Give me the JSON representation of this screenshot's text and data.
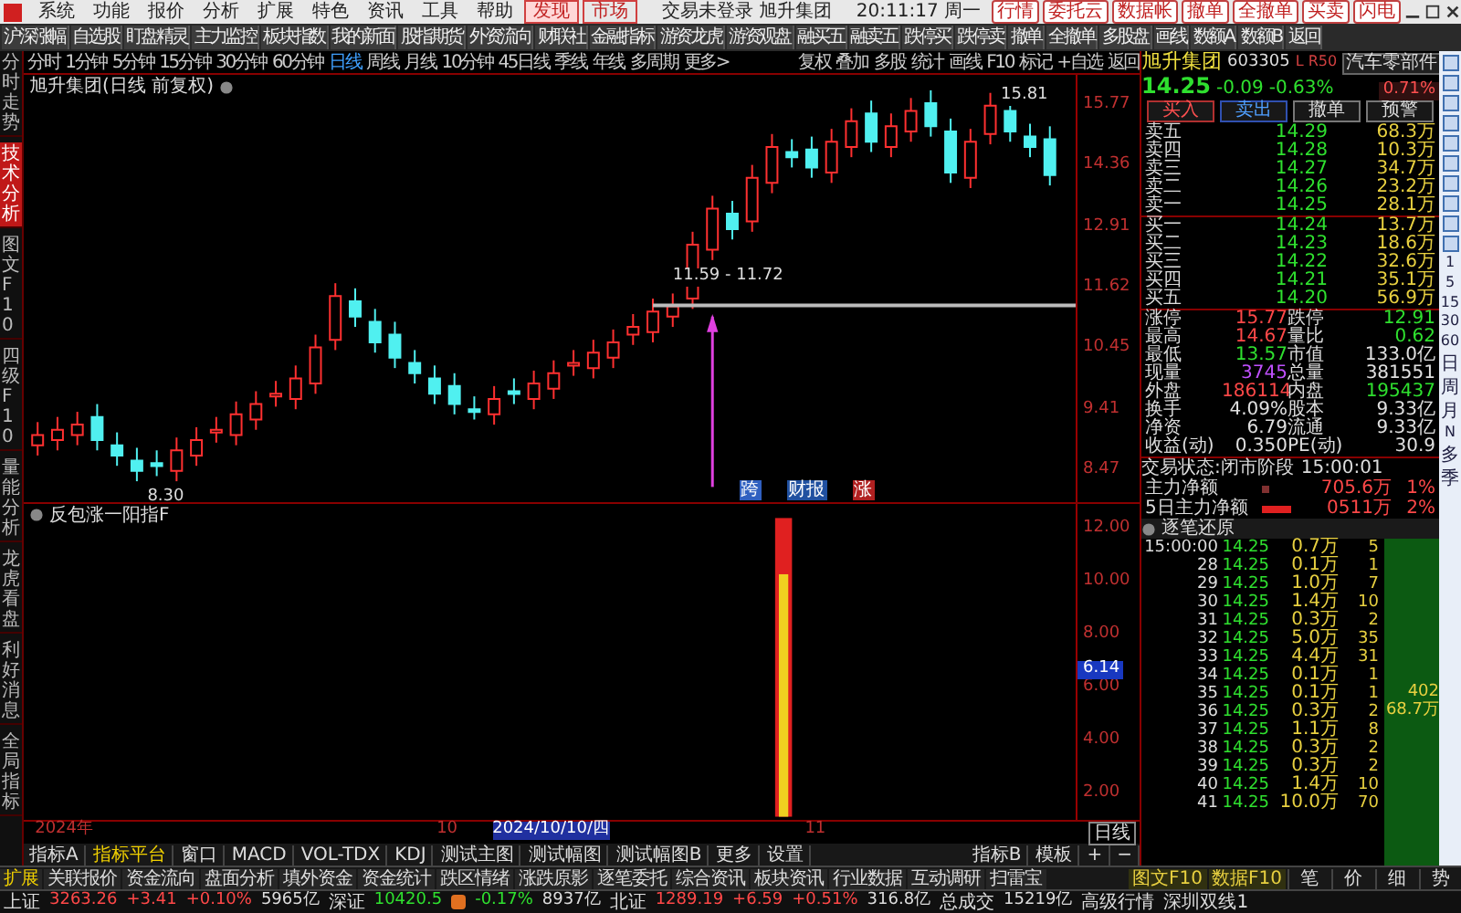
{
  "menu": {
    "items": [
      "系统",
      "功能",
      "报价",
      "分析",
      "扩展",
      "特色",
      "资讯",
      "工具",
      "帮助"
    ],
    "tabs": [
      {
        "label": "发现",
        "selected": true
      },
      {
        "label": "市场",
        "selected": false
      }
    ],
    "title": "交易未登录  旭升集团",
    "clock": "20:11:17 周一",
    "quick_buttons": [
      "行情",
      "委托云",
      "数据帐",
      "撤单",
      "全撤单",
      "买卖",
      "闪电"
    ]
  },
  "toolbar": [
    "沪深涨幅",
    "自选股",
    "盯盘精灵",
    "主力监控",
    "板块指数",
    "我的新面",
    "股指期货",
    "外资流向",
    "财联社",
    "金融指标",
    "游资龙虎",
    "游资观盘",
    "融买五",
    "融卖五",
    "跌停买",
    "跌停卖",
    "撤单",
    "全撤单",
    "多股盘",
    "画线",
    "数额A",
    "数额B",
    "返回"
  ],
  "side_tabs": [
    {
      "label": "分时走势",
      "selected": false
    },
    {
      "label": "技术分析",
      "selected": true
    },
    {
      "label": "图文F10",
      "selected": false
    },
    {
      "label": "四级F10",
      "selected": false
    },
    {
      "label": "量能分析",
      "selected": false
    },
    {
      "label": "龙虎看盘",
      "selected": false
    },
    {
      "label": "利好消息",
      "selected": false
    },
    {
      "label": "全局指标",
      "selected": false
    }
  ],
  "periods": [
    {
      "label": "分时",
      "selected": false
    },
    {
      "label": "1分钟",
      "selected": false
    },
    {
      "label": "5分钟",
      "selected": false
    },
    {
      "label": "15分钟",
      "selected": false
    },
    {
      "label": "30分钟",
      "selected": false
    },
    {
      "label": "60分钟",
      "selected": false
    },
    {
      "label": "日线",
      "selected": true
    },
    {
      "label": "周线",
      "selected": false
    },
    {
      "label": "月线",
      "selected": false
    },
    {
      "label": "10分钟",
      "selected": false
    },
    {
      "label": "45日线",
      "selected": false
    },
    {
      "label": "季线",
      "selected": false
    },
    {
      "label": "年线",
      "selected": false
    },
    {
      "label": "多周期",
      "selected": false
    },
    {
      "label": "更多>",
      "selected": false
    }
  ],
  "chart_tools": [
    "复权",
    "叠加",
    "多股",
    "统计",
    "画线",
    "F10",
    "标记",
    "+自选",
    "返回"
  ],
  "price_chart": {
    "title": "旭升集团(日线 前复权)",
    "axis_labels": [
      "15.77",
      "14.36",
      "12.91",
      "11.62",
      "10.45",
      "9.41",
      "8.47"
    ],
    "annotations": [
      {
        "kind": "high",
        "text": "15.81"
      },
      {
        "kind": "low",
        "text": "8.30"
      },
      {
        "kind": "range",
        "text": "11.59 - 11.72"
      }
    ],
    "events": [
      {
        "label": "跨",
        "kind": "notice"
      },
      {
        "label": "财报",
        "kind": "report"
      },
      {
        "label": "涨",
        "kind": "limit"
      }
    ]
  },
  "indicator": {
    "title": "反包涨一阳指F",
    "axis_labels": [
      "12.00",
      "10.00",
      "8.00",
      "6.00",
      "4.00",
      "2.00"
    ],
    "marker": "6.14"
  },
  "date_axis": [
    {
      "kind": "year",
      "text": "2024年"
    },
    {
      "kind": "month",
      "text": "10"
    },
    {
      "kind": "cursor",
      "text": "2024/10/10/四"
    },
    {
      "kind": "month",
      "text": "11"
    }
  ],
  "period_badge": "日线",
  "indicator_tabs": [
    {
      "label": "指标A",
      "selected": false
    },
    {
      "label": "指标平台",
      "selected": true
    },
    {
      "label": "窗口",
      "selected": false
    },
    {
      "label": "MACD",
      "selected": false
    },
    {
      "label": "VOL-TDX",
      "selected": false
    },
    {
      "label": "KDJ",
      "selected": false
    },
    {
      "label": "测试主图",
      "selected": false
    },
    {
      "label": "测试幅图",
      "selected": false
    },
    {
      "label": "测试幅图B",
      "selected": false
    },
    {
      "label": "更多",
      "selected": false
    },
    {
      "label": "设置",
      "selected": false
    }
  ],
  "indicator_tools": [
    "指标B",
    "模板",
    "+",
    "−"
  ],
  "quote": {
    "name": "旭升集团",
    "code": "603305",
    "tag": "L R50",
    "sector": "汽车零部件",
    "sector_change": "0.71%",
    "price": "14.25",
    "change": "-0.09",
    "pct": "-0.63%",
    "buttons": [
      "买入",
      "卖出",
      "撤单",
      "预警"
    ],
    "asks": [
      {
        "label": "卖五",
        "price": "14.29",
        "volume": "68.3万"
      },
      {
        "label": "卖四",
        "price": "14.28",
        "volume": "10.3万"
      },
      {
        "label": "卖三",
        "price": "14.27",
        "volume": "34.7万"
      },
      {
        "label": "卖二",
        "price": "14.26",
        "volume": "23.2万"
      },
      {
        "label": "卖一",
        "price": "14.25",
        "volume": "28.1万"
      }
    ],
    "bids": [
      {
        "label": "买一",
        "price": "14.24",
        "volume": "13.7万"
      },
      {
        "label": "买二",
        "price": "14.23",
        "volume": "18.6万"
      },
      {
        "label": "买三",
        "price": "14.22",
        "volume": "32.6万"
      },
      {
        "label": "买四",
        "price": "14.21",
        "volume": "35.1万"
      },
      {
        "label": "买五",
        "price": "14.20",
        "volume": "56.9万"
      }
    ],
    "stats": [
      {
        "cells": [
          {
            "label": "涨停",
            "value": "15.77",
            "color": "#ff4848"
          },
          {
            "label": "跌停",
            "value": "12.91",
            "color": "#2fe02f"
          }
        ]
      },
      {
        "cells": [
          {
            "label": "最高",
            "value": "14.67",
            "color": "#ff4848"
          },
          {
            "label": "量比",
            "value": "0.62",
            "color": "#2fe02f"
          }
        ]
      },
      {
        "cells": [
          {
            "label": "最低",
            "value": "13.57",
            "color": "#2fe02f"
          },
          {
            "label": "市值",
            "value": "133.0亿",
            "color": "#e0e0e0"
          }
        ]
      },
      {
        "cells": [
          {
            "label": "现量",
            "value": "3745",
            "color": "#c050ff"
          },
          {
            "label": "总量",
            "value": "381551",
            "color": "#e0e0e0"
          }
        ]
      },
      {
        "cells": [
          {
            "label": "外盘",
            "value": "186114",
            "color": "#ff4848"
          },
          {
            "label": "内盘",
            "value": "195437",
            "color": "#2fe02f"
          }
        ]
      },
      {
        "cells": [
          {
            "label": "换手",
            "value": "4.09%",
            "color": "#e0e0e0"
          },
          {
            "label": "股本",
            "value": "9.33亿",
            "color": "#e0e0e0"
          }
        ]
      },
      {
        "cells": [
          {
            "label": "净资",
            "value": "6.79",
            "color": "#e0e0e0"
          },
          {
            "label": "流通",
            "value": "9.33亿",
            "color": "#e0e0e0"
          }
        ]
      },
      {
        "cells": [
          {
            "label": "收益(动)",
            "value": "0.350",
            "color": "#e0e0e0"
          },
          {
            "label": "PE(动)",
            "value": "30.9",
            "color": "#e0e0e0"
          }
        ]
      }
    ],
    "state_label": "交易状态:闭市阶段",
    "state_time": "15:00:01",
    "capital": [
      {
        "label": "主力净额",
        "value": "705.6万",
        "pct": "1%"
      },
      {
        "label": "5日主力净额",
        "value": "0511万",
        "pct": "2%"
      }
    ],
    "trades_title": "逐笔还原",
    "trades": [
      {
        "time": "15:00:00",
        "price": "14.25",
        "volume": "0.7万",
        "count": "5"
      },
      {
        "time": "28",
        "price": "14.25",
        "volume": "0.1万",
        "count": "1"
      },
      {
        "time": "29",
        "price": "14.25",
        "volume": "1.0万",
        "count": "7"
      },
      {
        "time": "30",
        "price": "14.25",
        "volume": "1.4万",
        "count": "10"
      },
      {
        "time": "31",
        "price": "14.25",
        "volume": "0.3万",
        "count": "2"
      },
      {
        "time": "32",
        "price": "14.25",
        "volume": "5.0万",
        "count": "35"
      },
      {
        "time": "33",
        "price": "14.25",
        "volume": "4.4万",
        "count": "31"
      },
      {
        "time": "34",
        "price": "14.25",
        "volume": "0.1万",
        "count": "1"
      },
      {
        "time": "35",
        "price": "14.25",
        "volume": "0.1万",
        "count": "1"
      },
      {
        "time": "36",
        "price": "14.25",
        "volume": "0.3万",
        "count": "2"
      },
      {
        "time": "37",
        "price": "14.25",
        "volume": "1.1万",
        "count": "8"
      },
      {
        "time": "38",
        "price": "14.25",
        "volume": "0.3万",
        "count": "2"
      },
      {
        "time": "39",
        "price": "14.25",
        "volume": "0.3万",
        "count": "2"
      },
      {
        "time": "40",
        "price": "14.25",
        "volume": "1.4万",
        "count": "10"
      },
      {
        "time": "41",
        "price": "14.25",
        "volume": "10.0万",
        "count": "70"
      }
    ],
    "trade_sum_count": "402",
    "trade_sum_volume": "68.7万"
  },
  "right_strip_labels": [
    "1",
    "5",
    "15",
    "30",
    "60",
    "日",
    "周",
    "月",
    "N",
    "多",
    "季"
  ],
  "ext_tabs": [
    "扩展",
    "关联报价",
    "资金流向",
    "盘面分析",
    "填外资金",
    "资金统计",
    "跌区情绪",
    "涨跌原影",
    "逐笔委托",
    "综合资讯",
    "板块资讯",
    "行业数据",
    "互动调研",
    "扫雷宝"
  ],
  "ext_right": [
    "图文F10",
    "数据F10"
  ],
  "detail_tabs": [
    "笔",
    "价",
    "细",
    "势"
  ],
  "status_bar": {
    "indices": [
      {
        "name": "上证",
        "value": "3263.26",
        "change": "+3.41",
        "pct": "+0.10%",
        "amount": "5965亿",
        "color": "#ff4848"
      },
      {
        "name": "深证",
        "value": "10420.5",
        "pct": "-0.17%",
        "amount": "8937亿",
        "color": "#2fe02f"
      },
      {
        "name": "北证",
        "value": "1289.19",
        "change": "+6.59",
        "pct": "+0.51%",
        "amount": "316.8亿",
        "color": "#ff4848"
      }
    ],
    "total_label": "总成交",
    "total_value": "15219亿",
    "feed": "高级行情",
    "line": "深圳双线1"
  }
}
